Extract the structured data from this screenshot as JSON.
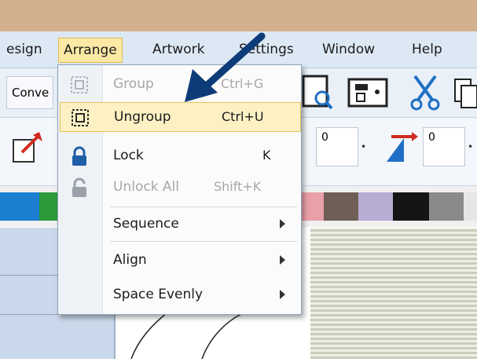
{
  "menubar": {
    "items": [
      "esign",
      "Arrange",
      "Artwork",
      "Settings",
      "Window",
      "Help"
    ],
    "active": "Arrange"
  },
  "toolbar": {
    "convert_label": "Conve",
    "field1": "0",
    "field2": "0"
  },
  "arrange_menu": {
    "items": [
      {
        "label": "Group",
        "shortcut": "Ctrl+G",
        "enabled": false,
        "icon": "group-icon"
      },
      {
        "label": "Ungroup",
        "shortcut": "Ctrl+U",
        "enabled": true,
        "highlighted": true,
        "icon": "ungroup-icon"
      },
      {
        "label": "Lock",
        "shortcut": "K",
        "enabled": true,
        "icon": "lock-icon"
      },
      {
        "label": "Unlock All",
        "shortcut": "Shift+K",
        "enabled": false,
        "icon": "unlock-icon"
      },
      {
        "label": "Sequence",
        "has_submenu": true
      },
      {
        "label": "Align",
        "has_submenu": true
      },
      {
        "label": "Space Evenly",
        "has_submenu": true
      }
    ]
  },
  "palette_colors": [
    "#1a7fd1",
    "#2c9a3b",
    "#eaa0a8",
    "#6f5e55",
    "#b7acd3",
    "#151515",
    "#8a8a8a"
  ],
  "annotation_color": "#0d3c78"
}
